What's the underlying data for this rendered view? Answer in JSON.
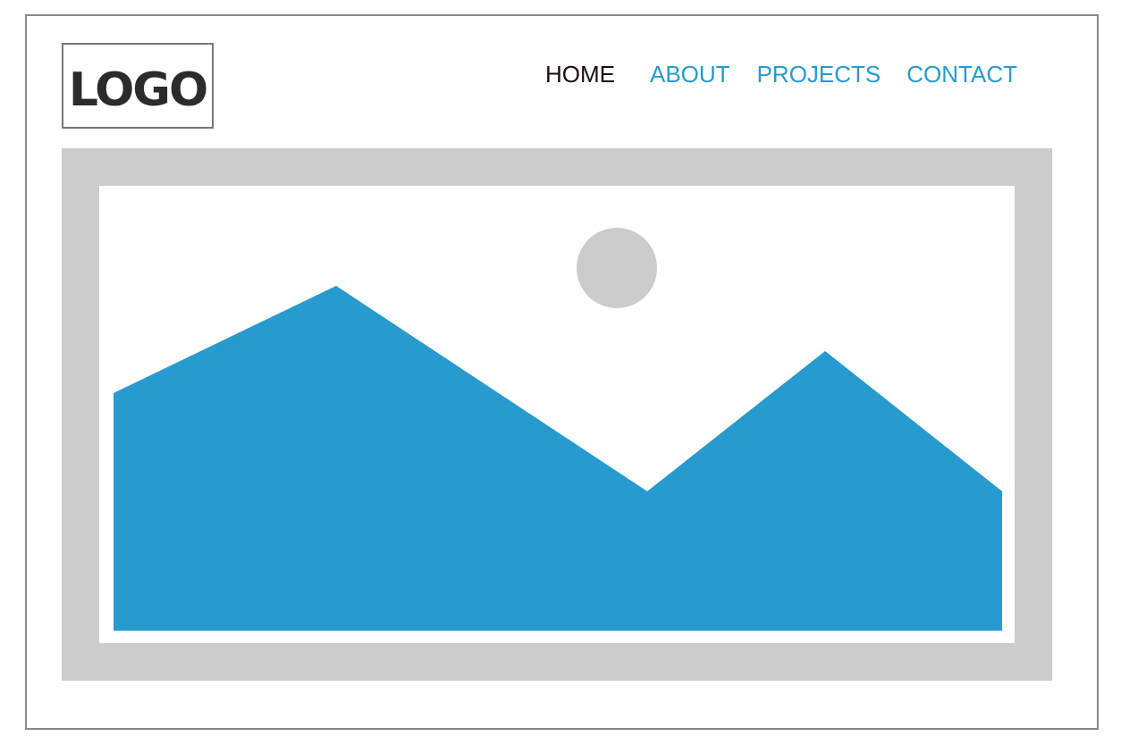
{
  "header": {
    "logo_text": "LOGO"
  },
  "nav": {
    "items": [
      {
        "label": "HOME",
        "active": true
      },
      {
        "label": "ABOUT",
        "active": false
      },
      {
        "label": "PROJECTS",
        "active": false
      },
      {
        "label": "CONTACT",
        "active": false
      }
    ]
  },
  "hero": {
    "icon": "image-placeholder-icon",
    "colors": {
      "frame": "#cccccc",
      "canvas": "#ffffff",
      "mountains": "#279acf",
      "sun": "#cccccc"
    }
  },
  "colors": {
    "nav_link": "#279acf",
    "nav_active": "#1d0c0c",
    "logo_text": "#2b2b2b",
    "border": "#888888"
  }
}
